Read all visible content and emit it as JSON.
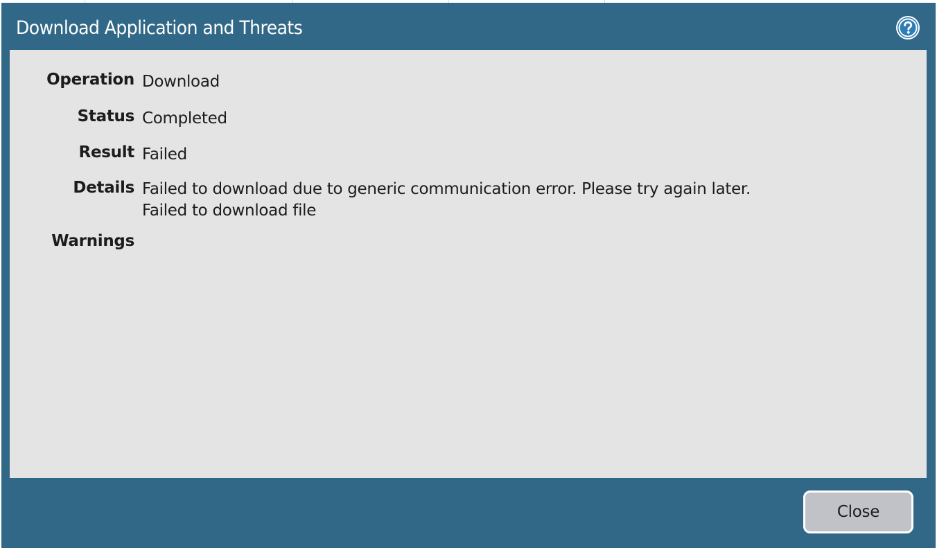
{
  "dialog": {
    "title": "Download Application and Threats",
    "help_icon": "help-question-icon"
  },
  "fields": [
    {
      "label": "Operation",
      "value": "Download"
    },
    {
      "label": "Status",
      "value": "Completed"
    },
    {
      "label": "Result",
      "value": "Failed"
    },
    {
      "label": "Details",
      "value_lines": [
        "Failed to download due to generic communication error. Please try again later.",
        "Failed to download file"
      ]
    },
    {
      "label": "Warnings",
      "value": ""
    }
  ],
  "footer": {
    "close_label": "Close"
  },
  "colors": {
    "frame": "#316887",
    "content_bg": "#e4e4e4",
    "button_bg": "#c0c2c8",
    "help_icon": "#2e7db5"
  }
}
